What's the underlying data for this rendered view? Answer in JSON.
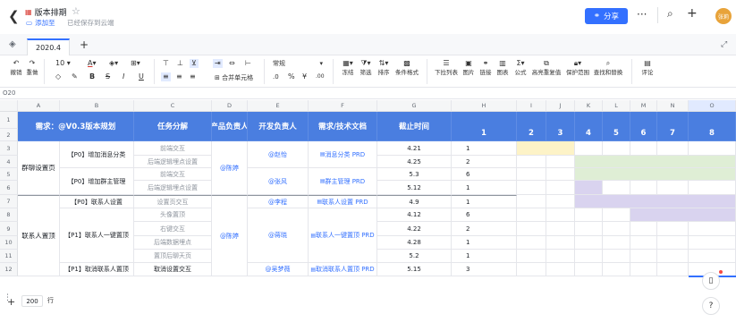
{
  "header": {
    "title": "版本排期",
    "add_tag": "添加至",
    "saved_status": "已经保存到云端",
    "share_label": "分享",
    "avatar_text": "张莉",
    "more": "···"
  },
  "tabs": {
    "sheet": "2020.4",
    "add": "+"
  },
  "toolbar": {
    "undo": "撤销",
    "redo": "重做",
    "font_size": "10",
    "number_format": "常规",
    "merge": "合并单元格",
    "percent": "%",
    "currency": "¥",
    "freeze": "冻结",
    "filter": "筛选",
    "sort": "排序",
    "cond_format": "条件格式",
    "dropdown": "下拉列表",
    "image": "图片",
    "link": "链接",
    "chart": "图表",
    "formula": "公式",
    "dup": "高亮重复值",
    "protect": "保护范围",
    "find": "查找和替换",
    "comment": "评论"
  },
  "formula_bar": {
    "cell_ref": "O20"
  },
  "columns": [
    "A",
    "B",
    "C",
    "D",
    "E",
    "F",
    "G",
    "H",
    "I",
    "J",
    "K",
    "L",
    "M",
    "N",
    "O"
  ],
  "rows": [
    "1",
    "2",
    "3",
    "4",
    "5",
    "6",
    "7",
    "8",
    "9",
    "10",
    "11",
    "12"
  ],
  "sheet": {
    "header": {
      "title": "需求：@V0.3版本规划",
      "task": "任务分解",
      "pm": "产品负责人",
      "dev": "开发负责人",
      "doc": "需求/技术文档",
      "deadline": "截止时间",
      "weeks": [
        "1",
        "2",
        "3",
        "4",
        "5",
        "6",
        "7",
        "8"
      ]
    },
    "groups": [
      "群聊设置页",
      "联系人置顶"
    ],
    "features": [
      "【P0】增加消息分类",
      "【P0】增加群主管理",
      "【P0】联系人设置",
      "【P1】联系人一键置顶",
      "【P1】取消联系人置顶"
    ],
    "tasks": [
      "前端交互",
      "后端逻辑埋点设置",
      "前端交互",
      "后端逻辑埋点设置",
      "设置页交互",
      "头像置顶",
      "右键交互",
      "后端数据埋点",
      "置顶后聊天页",
      "取消设置交互"
    ],
    "pms": [
      "@陈婷",
      "@陈婷"
    ],
    "devs": [
      "@赵怡",
      "@张风",
      "@李程",
      "@蒋晓",
      "@吴梦薇"
    ],
    "docs": [
      "消息分类 PRD",
      "群主管理 PRD",
      "联系人设置 PRD",
      "联系人一键置顶 PRD",
      "取消联系人置顶 PRD"
    ],
    "deadlines": [
      "4.21",
      "4.25",
      "5.3",
      "5.12",
      "4.9",
      "4.12",
      "4.22",
      "4.28",
      "5.2",
      "5.15"
    ],
    "durations": [
      "1",
      "2",
      "6",
      "1",
      "1",
      "6",
      "2",
      "1",
      "1",
      "3"
    ]
  },
  "footer": {
    "row_count": "200",
    "row_unit": "行",
    "add": "+"
  },
  "colors": {
    "header_blue": "#4a7ee0",
    "yellow": "#fdf3c7",
    "green": "#dfeed5",
    "purple": "#d9d3ef",
    "accent": "#3370ff"
  }
}
